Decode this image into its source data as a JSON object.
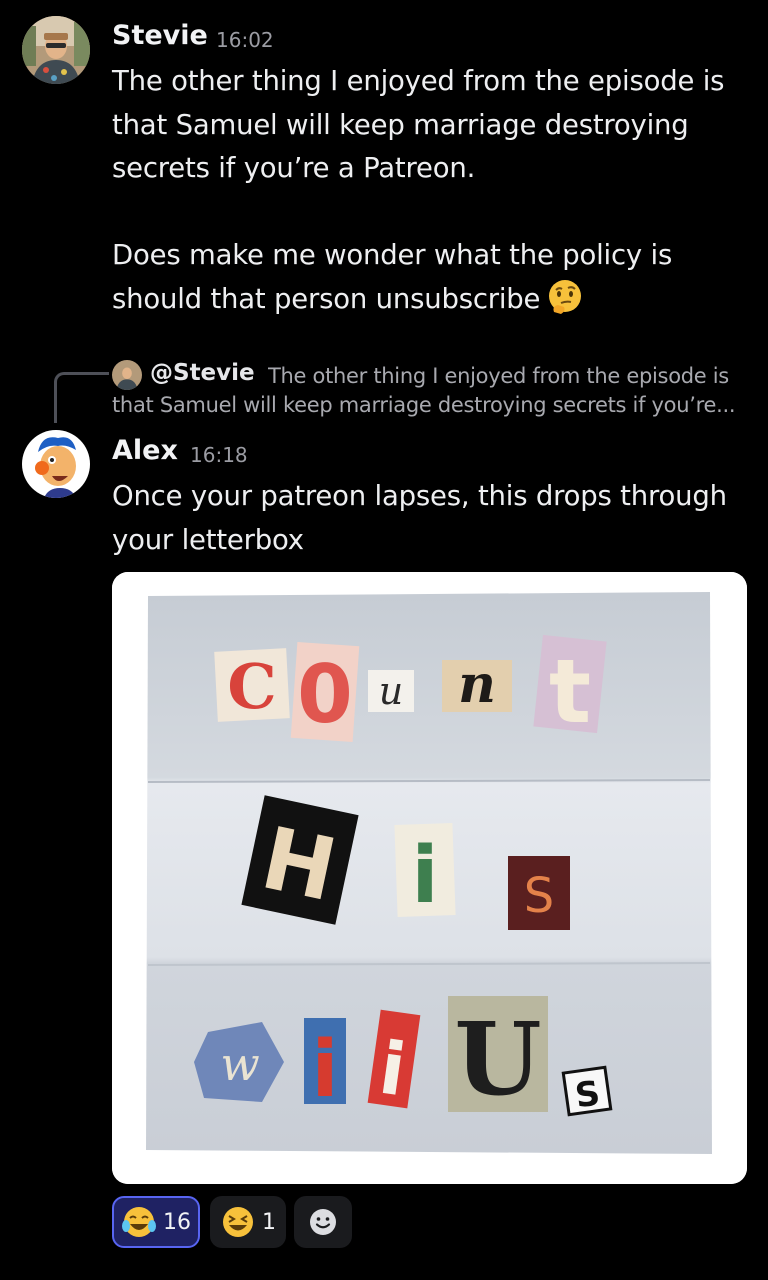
{
  "messages": [
    {
      "author": "Stevie",
      "time": "16:02",
      "paragraphs": [
        [
          "The other thing I enjoyed from the episode is",
          "that Samuel will keep marriage destroying",
          "secrets if you’re a Patreon."
        ],
        [
          "Does make me wonder what the policy is",
          "should that person unsubscribe"
        ]
      ],
      "emoji": "thinking-face"
    },
    {
      "author": "Alex",
      "time": "16:18",
      "reply": {
        "mention": "@Stevie",
        "preview_line1": "The other thing I enjoyed from the episode is",
        "preview_line2": "that Samuel will keep marriage destroying secrets if you’re..."
      },
      "lines": [
        "Once your patreon lapses, this drops through",
        "your letterbox"
      ],
      "attachment": {
        "type": "image",
        "rows": [
          [
            "C",
            "0",
            "u",
            "n",
            "t"
          ],
          [
            "H",
            "i",
            "S"
          ],
          [
            "w",
            "i",
            "i",
            "U",
            "S"
          ]
        ]
      }
    }
  ],
  "reactions": [
    {
      "emoji": "tears-of-joy",
      "count": "16",
      "selected": true
    },
    {
      "emoji": "laughing-face",
      "count": "1",
      "selected": false
    },
    {
      "emoji": "add-reaction",
      "count": "",
      "selected": false
    }
  ],
  "colors": {
    "background": "#000000",
    "selected_reaction_bg": "#1f2263",
    "selected_reaction_border": "#5865f2",
    "reaction_bg": "#1a1b1e"
  }
}
